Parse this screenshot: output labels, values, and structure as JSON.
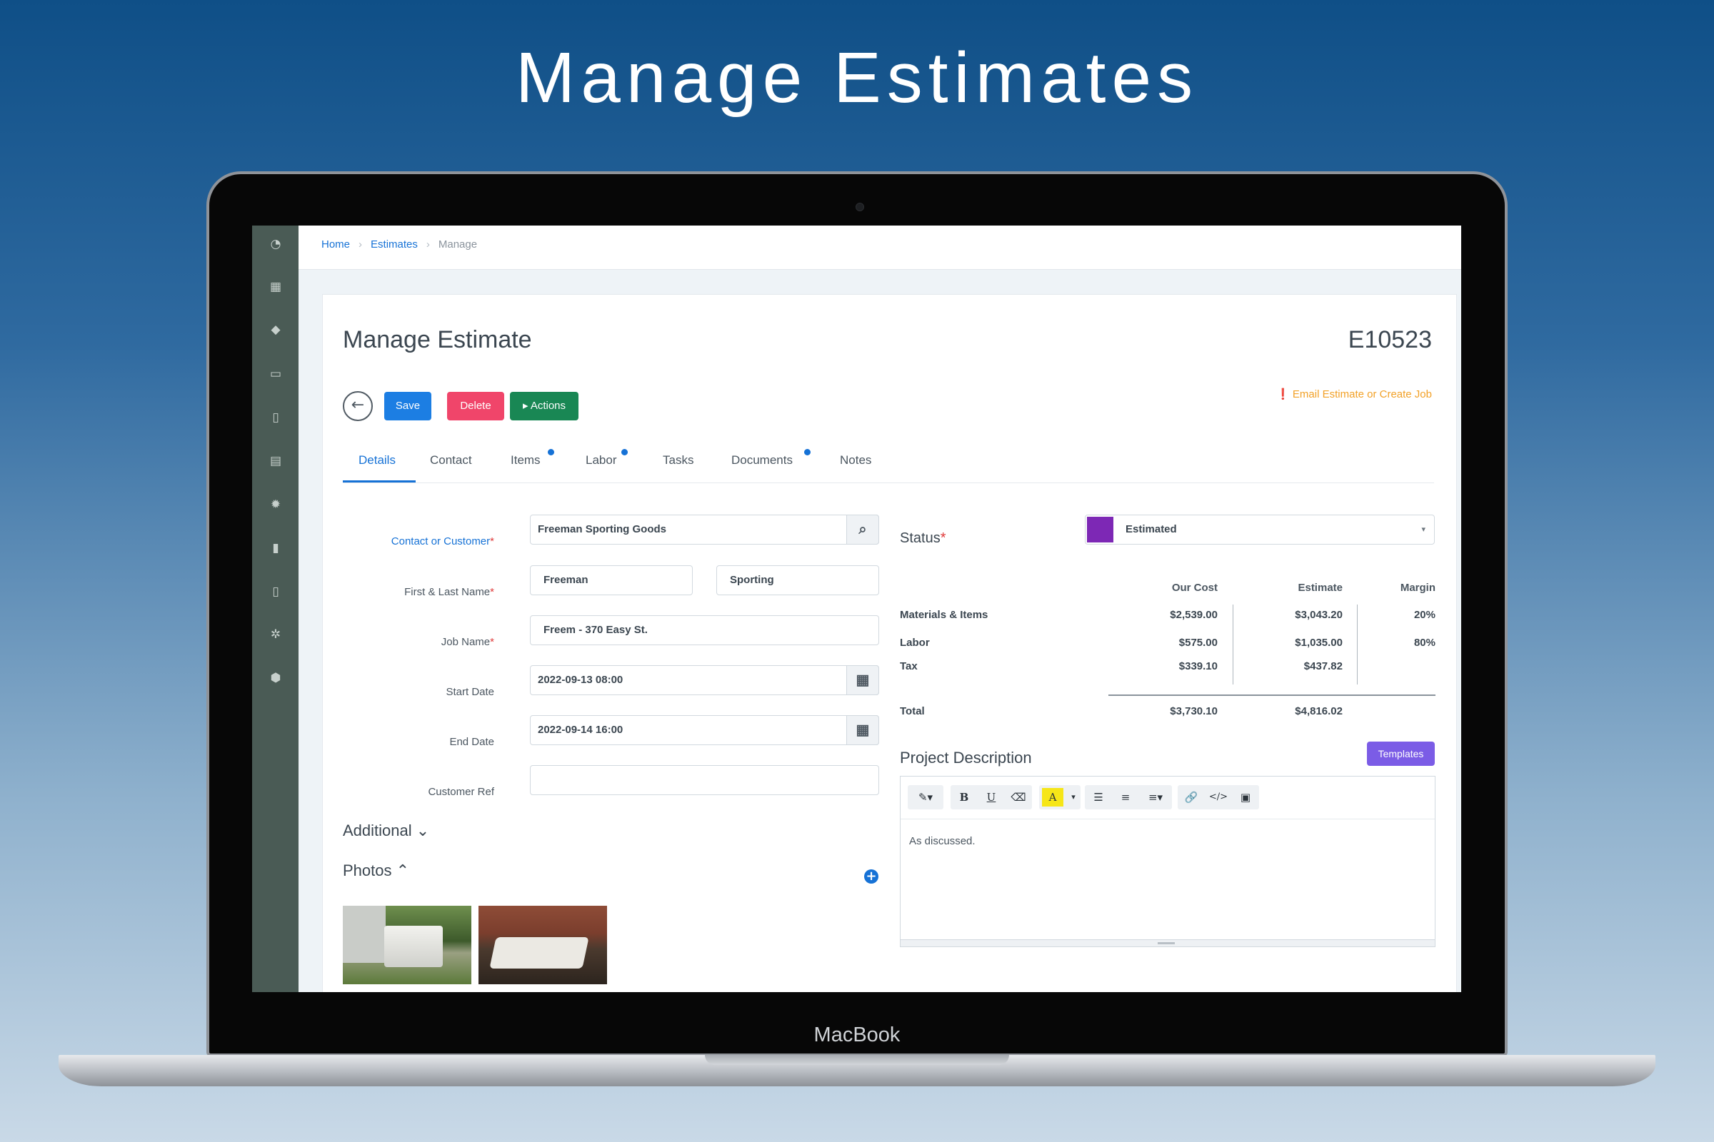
{
  "hero": {
    "title": "Manage Estimates"
  },
  "device": {
    "label": "MacBook"
  },
  "breadcrumb": {
    "home": "Home",
    "estimates": "Estimates",
    "current": "Manage",
    "separator": "›"
  },
  "page": {
    "title": "Manage Estimate",
    "estimate_id": "E10523"
  },
  "toolbar": {
    "back_icon": "←",
    "save_label": "Save",
    "delete_label": "Delete",
    "actions_label": "▸ Actions",
    "email_link": "❗ Email Estimate or Create Job"
  },
  "tabs": [
    {
      "label": "Details",
      "active": true,
      "dot": false
    },
    {
      "label": "Contact",
      "active": false,
      "dot": false
    },
    {
      "label": "Items",
      "active": false,
      "dot": true
    },
    {
      "label": "Labor",
      "active": false,
      "dot": true
    },
    {
      "label": "Tasks",
      "active": false,
      "dot": false
    },
    {
      "label": "Documents",
      "active": false,
      "dot": true
    },
    {
      "label": "Notes",
      "active": false,
      "dot": false
    }
  ],
  "form": {
    "contact_label": "Contact or Customer",
    "contact_value": "Freeman Sporting Goods",
    "name_label": "First & Last Name",
    "first_name": "Freeman",
    "last_name": "Sporting",
    "job_label": "Job Name",
    "job_value": "Freem - 370 Easy St.",
    "start_label": "Start Date",
    "start_value": "2022-09-13 08:00",
    "end_label": "End Date",
    "end_value": "2022-09-14 16:00",
    "ref_label": "Customer Ref",
    "ref_value": "",
    "required_mark": "*"
  },
  "sections": {
    "additional": "Additional ⌄",
    "photos": "Photos ⌃",
    "add_icon": "+"
  },
  "status": {
    "label": "Status",
    "value": "Estimated",
    "swatch_color": "#7d28b5",
    "caret": "▾"
  },
  "costs": {
    "headers": {
      "our_cost": "Our Cost",
      "estimate": "Estimate",
      "margin": "Margin"
    },
    "rows": [
      {
        "label": "Materials & Items",
        "our_cost": "$2,539.00",
        "estimate": "$3,043.20",
        "margin": "20%"
      },
      {
        "label": "Labor",
        "our_cost": "$575.00",
        "estimate": "$1,035.00",
        "margin": "80%"
      },
      {
        "label": "Tax",
        "our_cost": "$339.10",
        "estimate": "$437.82",
        "margin": ""
      }
    ],
    "total": {
      "label": "Total",
      "our_cost": "$3,730.10",
      "estimate": "$4,816.02"
    }
  },
  "description": {
    "label": "Project Description",
    "templates_label": "Templates",
    "text": "As discussed."
  },
  "editor_toolbar": {
    "magic": "✎▾",
    "bold": "B",
    "underline": "U",
    "eraser": "⌫",
    "highlight": "A",
    "highlight_caret": "▾",
    "bullet_list": "☰",
    "num_list": "≡",
    "align": "≡▾",
    "link": "🔗",
    "code": "</>",
    "image": "▣"
  },
  "sidebar_icons": [
    "dashboard-icon",
    "calendar-icon",
    "tags-icon",
    "inbox-icon",
    "clipboard-icon",
    "chat-icon",
    "gear-badge-icon",
    "bookmark-icon",
    "file-icon",
    "settings-icon",
    "shield-icon"
  ]
}
